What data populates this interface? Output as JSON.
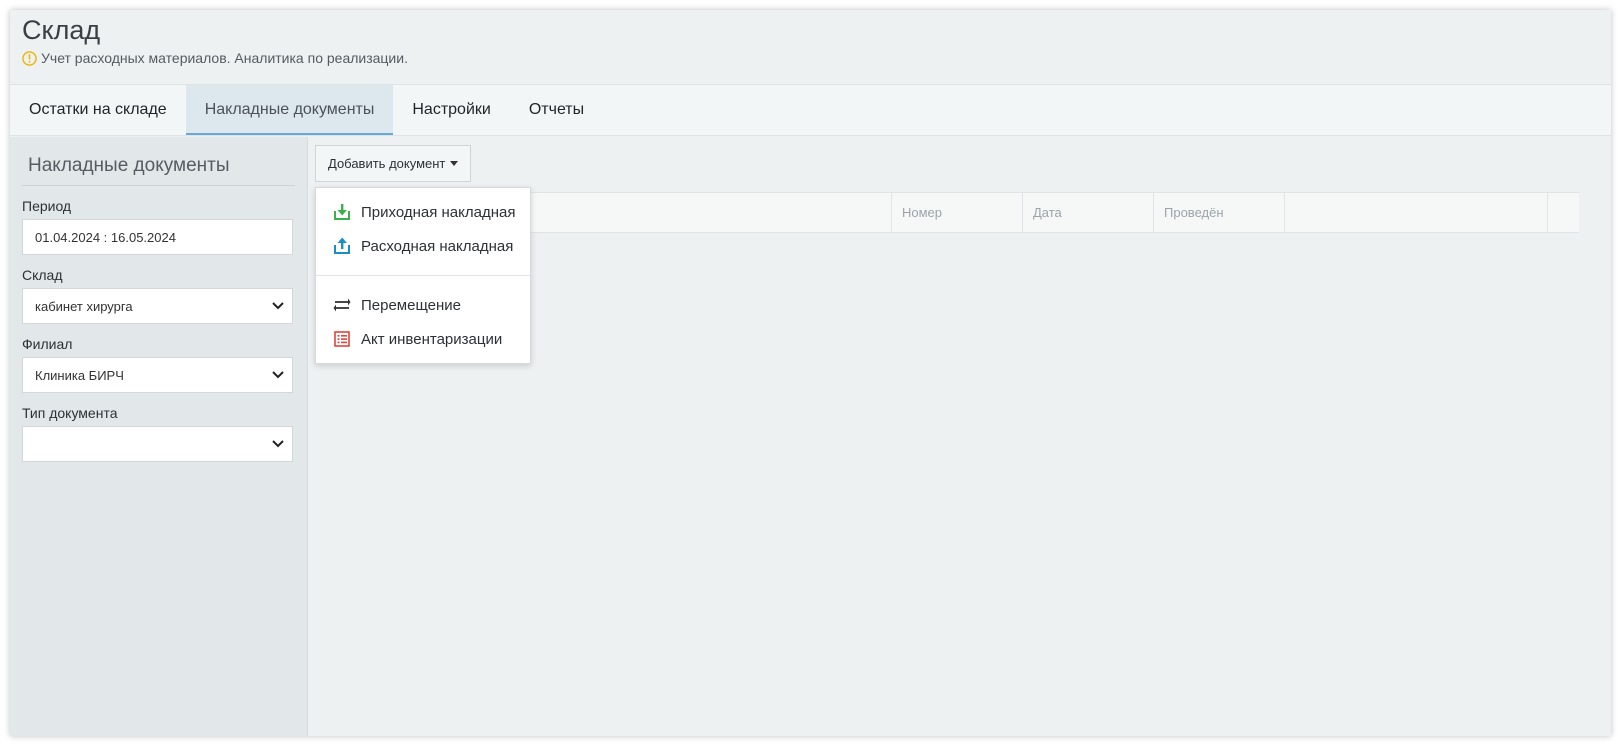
{
  "header": {
    "title": "Склад",
    "subtitle": "Учет расходных материалов. Аналитика по реализации."
  },
  "tabs": [
    {
      "label": "Остатки на складе",
      "active": false
    },
    {
      "label": "Накладные документы",
      "active": true
    },
    {
      "label": "Настройки",
      "active": false
    },
    {
      "label": "Отчеты",
      "active": false
    }
  ],
  "sidebar": {
    "title": "Накладные документы",
    "period_label": "Период",
    "period_value": "01.04.2024 : 16.05.2024",
    "warehouse_label": "Склад",
    "warehouse_value": "кабинет хирурга",
    "branch_label": "Филиал",
    "branch_value": "Клиника БИРЧ",
    "doc_type_label": "Тип документа",
    "doc_type_value": ""
  },
  "toolbar": {
    "add_document_label": "Добавить документ"
  },
  "dropdown": {
    "items": [
      {
        "label": "Приходная накладная",
        "icon": "download-icon"
      },
      {
        "label": "Расходная накладная",
        "icon": "upload-icon"
      },
      {
        "label": "Перемещение",
        "icon": "transfer-icon"
      },
      {
        "label": "Акт инвентаризации",
        "icon": "list-icon"
      }
    ]
  },
  "table": {
    "columns": [
      "",
      "Номер",
      "Дата",
      "Проведён",
      ""
    ]
  },
  "colors": {
    "accent": "#6aa9d4",
    "incoming": "#3cb14a",
    "outgoing": "#1a8fc4",
    "inventory": "#e0453a",
    "info": "#f0b400"
  }
}
